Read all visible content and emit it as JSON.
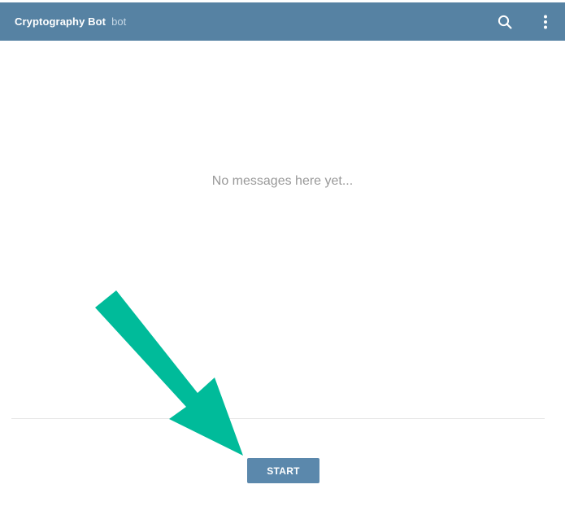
{
  "header": {
    "title": "Cryptography Bot",
    "subtitle": "bot",
    "background_color": "#5682a3",
    "icons": [
      "search-icon",
      "more-vertical-icon"
    ]
  },
  "chat": {
    "empty_message": "No messages here yet..."
  },
  "composer": {
    "start_label": "START",
    "button_color": "#5b88ac"
  },
  "annotation": {
    "arrow_color": "#00bb9a",
    "points_to": "start-button"
  }
}
